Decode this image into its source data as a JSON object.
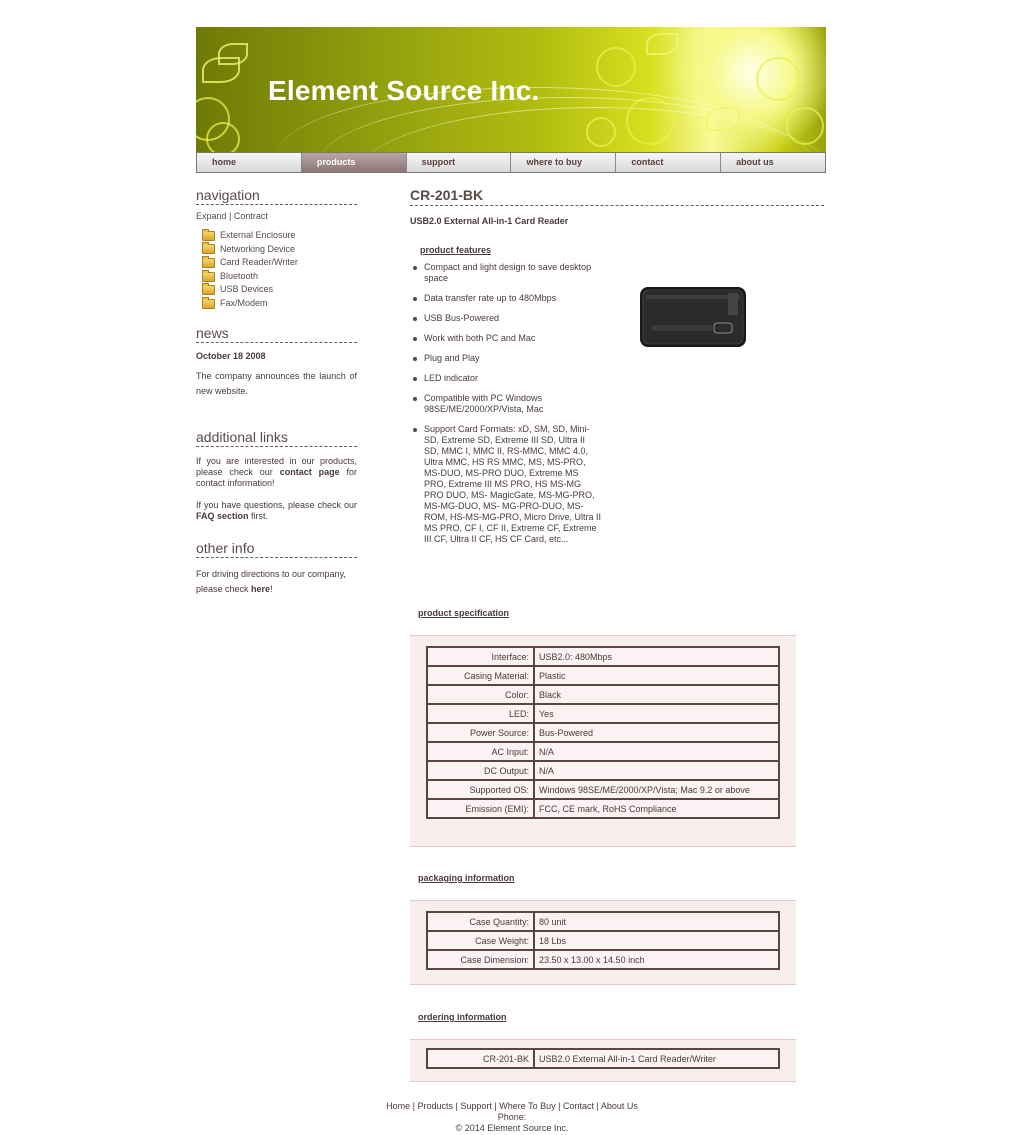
{
  "header": {
    "site_title": "Element Source Inc."
  },
  "nav": [
    {
      "label": "home",
      "active": false
    },
    {
      "label": "products",
      "active": true
    },
    {
      "label": "support",
      "active": false
    },
    {
      "label": "where to buy",
      "active": false
    },
    {
      "label": "contact",
      "active": false
    },
    {
      "label": "about us",
      "active": false
    }
  ],
  "sidebar": {
    "navigation": {
      "heading": "navigation",
      "expand": "Expand",
      "separator": "|",
      "contract": "Contract",
      "items": [
        "External Enclosure",
        "Networking Device",
        "Card Reader/Writer",
        "Bluetooth",
        "USB Devices",
        "Fax/Modem"
      ]
    },
    "news": {
      "heading": "news",
      "date": "October 18 2008",
      "text": "The company announces the launch of new website."
    },
    "additional_links": {
      "heading": "additional links",
      "p1_before": "If you are interested in our products, please check our ",
      "p1_link": "contact page",
      "p1_after": " for contact information!",
      "p2_before": "If you have questions, please check our ",
      "p2_link": "FAQ section",
      "p2_after": " first."
    },
    "other_info": {
      "heading": "other info",
      "text_before": "For driving directions to our company, please check ",
      "link": "here",
      "text_after": "!"
    }
  },
  "product": {
    "title": "CR-201-BK",
    "subtitle": "USB2.0 External All-in-1 Card Reader",
    "features_heading": "product features",
    "features": [
      "Compact and light design to save desktop space",
      "Data transfer rate up to 480Mbps",
      "USB Bus-Powered",
      "Work with both PC and Mac",
      "Plug and Play",
      "LED indicator",
      "Compatible with PC Windows 98SE/ME/2000/XP/Vista, Mac",
      "Support Card Formats: xD, SM, SD, Mini-SD, Extreme SD, Extreme III SD, Ultra II SD, MMC I, MMC II, RS-MMC, MMC 4.0, Ultra MMC, HS RS MMC, MS, MS-PRO, MS-DUO, MS-PRO DUO, Extreme MS PRO, Extreme III MS PRO, HS MS-MG PRO DUO, MS- MagicGate, MS-MG-PRO, MS-MG-DUO, MS- MG-PRO-DUO, MS-ROM, HS-MS-MG-PRO, Micro Drive, Ultra II MS PRO, CF I, CF II, Extreme CF, Extreme III CF, Ultra II CF, HS CF Card, etc..."
    ],
    "specification_heading": "product specification",
    "specification": [
      {
        "k": "Interface:",
        "v": "USB2.0: 480Mbps"
      },
      {
        "k": "Casing Material:",
        "v": "Plastic"
      },
      {
        "k": "Color:",
        "v": "Black"
      },
      {
        "k": "LED:",
        "v": "Yes"
      },
      {
        "k": "Power Source:",
        "v": "Bus-Powered"
      },
      {
        "k": "AC Input:",
        "v": "N/A"
      },
      {
        "k": "DC Output:",
        "v": "N/A"
      },
      {
        "k": "Supported OS:",
        "v": "Windows 98SE/ME/2000/XP/Vista; Mac 9.2 or above"
      },
      {
        "k": "Emission (EMI):",
        "v": "FCC, CE mark, RoHS Compliance"
      }
    ],
    "packaging_heading": "packaging information",
    "packaging": [
      {
        "k": "Case Quantity:",
        "v": "80 unit"
      },
      {
        "k": "Case Weight:",
        "v": "18 Lbs"
      },
      {
        "k": "Case Dimension:",
        "v": "23.50 x 13.00 x 14.50 inch"
      }
    ],
    "ordering_heading": "ordering information",
    "ordering": [
      {
        "k": "CR-201-BK",
        "v": "USB2.0 External All-in-1 Card Reader/Writer"
      }
    ]
  },
  "footer": {
    "links": [
      "Home",
      "Products",
      "Support",
      "Where To Buy",
      "Contact",
      "About Us"
    ],
    "separator": " | ",
    "phone": "Phone:",
    "copyright": "© 2014 Element Source Inc."
  }
}
